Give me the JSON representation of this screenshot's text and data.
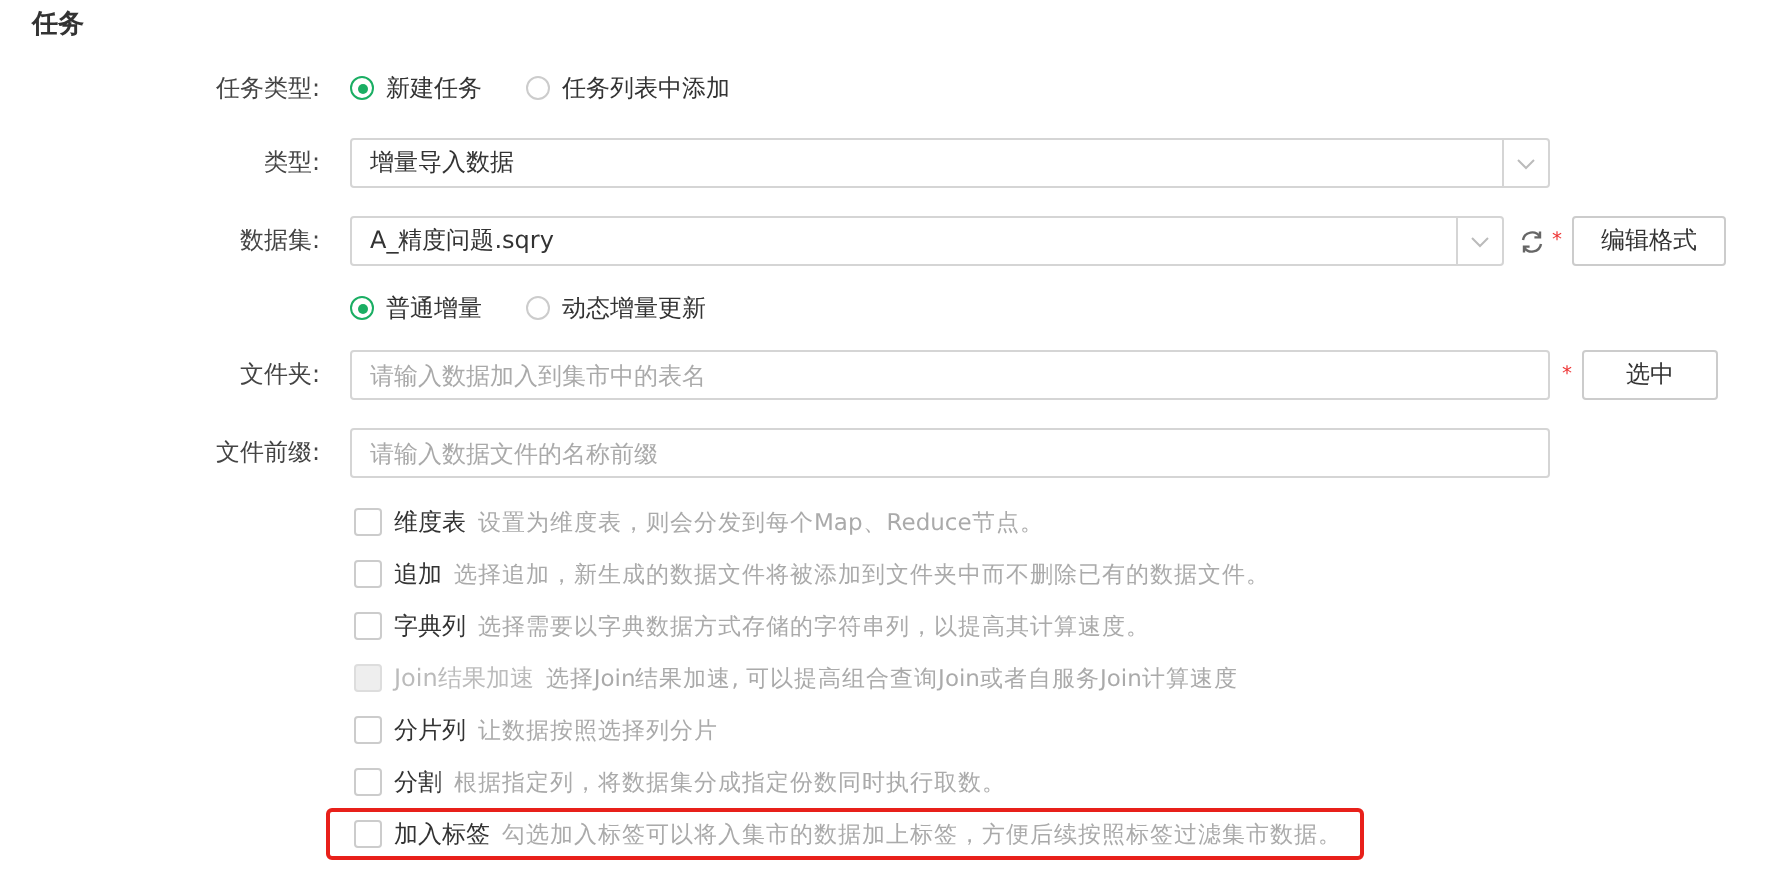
{
  "section_title": "任务",
  "task_type": {
    "label": "任务类型:",
    "options": [
      {
        "label": "新建任务",
        "selected": true
      },
      {
        "label": "任务列表中添加",
        "selected": false
      }
    ]
  },
  "type": {
    "label": "类型:",
    "value": "增量导入数据"
  },
  "dataset": {
    "label": "数据集:",
    "value": "A_精度问题.sqry",
    "required_mark": "*",
    "button": "编辑格式"
  },
  "update_mode": {
    "options": [
      {
        "label": "普通增量",
        "selected": true
      },
      {
        "label": "动态增量更新",
        "selected": false
      }
    ]
  },
  "folder": {
    "label": "文件夹:",
    "placeholder": "请输入数据加入到集市中的表名",
    "required_mark": "*",
    "button": "选中"
  },
  "file_prefix": {
    "label": "文件前缀:",
    "placeholder": "请输入数据文件的名称前缀"
  },
  "options": [
    {
      "label": "维度表",
      "description": "设置为维度表，则会分发到每个Map、Reduce节点。",
      "checked": false,
      "disabled": false,
      "highlighted": false
    },
    {
      "label": "追加",
      "description": "选择追加，新生成的数据文件将被添加到文件夹中而不删除已有的数据文件。",
      "checked": false,
      "disabled": false,
      "highlighted": false
    },
    {
      "label": "字典列",
      "description": "选择需要以字典数据方式存储的字符串列，以提高其计算速度。",
      "checked": false,
      "disabled": false,
      "highlighted": false
    },
    {
      "label": "Join结果加速",
      "description": "选择Join结果加速, 可以提高组合查询Join或者自服务Join计算速度",
      "checked": false,
      "disabled": true,
      "highlighted": false
    },
    {
      "label": "分片列",
      "description": "让数据按照选择列分片",
      "checked": false,
      "disabled": false,
      "highlighted": false
    },
    {
      "label": "分割",
      "description": "根据指定列，将数据集分成指定份数同时执行取数。",
      "checked": false,
      "disabled": false,
      "highlighted": false
    },
    {
      "label": "加入标签",
      "description": "勾选加入标签可以将入集市的数据加上标签，方便后续按照标签过滤集市数据。",
      "checked": false,
      "disabled": false,
      "highlighted": true
    }
  ]
}
